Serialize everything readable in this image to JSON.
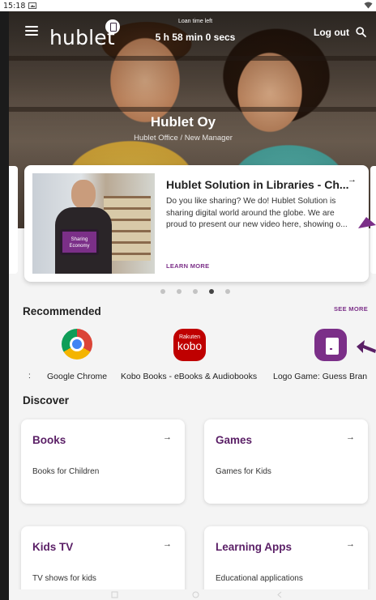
{
  "status_bar": {
    "time": "15:18"
  },
  "header": {
    "logo": "hublet",
    "loan_label": "Loan time left",
    "loan_time": "5 h 58 min 0 secs",
    "logout_label": "Log out"
  },
  "hero": {
    "org_name": "Hublet Oy",
    "org_subtitle": "Hublet Office / New Manager"
  },
  "featured": {
    "title": "Hublet Solution in Libraries - Ch...",
    "description": "Do you like sharing? We do! Hublet Solution is sharing digital world around the globe. We are proud to present our new video here, showing o...",
    "learn_more": "LEARN MORE",
    "thumb_caption": "Sharing Economy",
    "dots_total": 5,
    "dots_active": 4
  },
  "recommended": {
    "title": "Recommended",
    "see_more": "SEE MORE",
    "edge_mark": ":",
    "apps": [
      {
        "label": "Google Chrome",
        "icon": "chrome-icon"
      },
      {
        "label": "Kobo Books - eBooks & Audiobooks",
        "icon": "kobo-icon",
        "icon_text_top": "Rakuten",
        "icon_text": "kobo"
      },
      {
        "label": "Logo Game: Guess Bran",
        "icon": "tablet-icon"
      }
    ]
  },
  "discover": {
    "title": "Discover",
    "cards": [
      {
        "title": "Books",
        "subtitle": "Books for Children"
      },
      {
        "title": "Games",
        "subtitle": "Games for Kids"
      },
      {
        "title": "Kids TV",
        "subtitle": "TV shows for kids"
      },
      {
        "title": "Learning Apps",
        "subtitle": "Educational applications"
      }
    ]
  },
  "colors": {
    "brand": "#7b2f88",
    "discover_title": "#5a1f66"
  }
}
